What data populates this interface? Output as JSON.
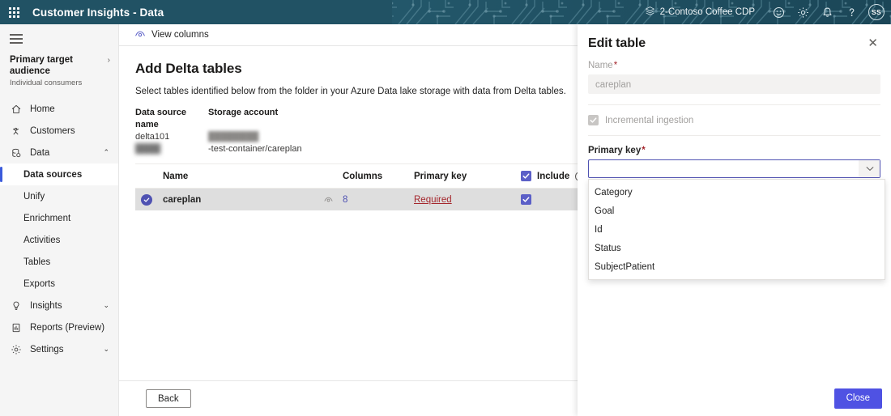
{
  "header": {
    "app_title": "Customer Insights - Data",
    "waffle_icon": "app-launcher-icon",
    "environment": "2-Contoso Coffee CDP",
    "environment_icon": "environment-icon",
    "icons": [
      {
        "name": "feedback-smiley-icon"
      },
      {
        "name": "gear-icon"
      },
      {
        "name": "bell-notification-icon"
      },
      {
        "name": "help-question-icon"
      }
    ],
    "avatar_initials": "SS",
    "bg_color": "#1f4e5f",
    "accent_color": "#4f52b2"
  },
  "sidebar": {
    "hamburger_icon": "hamburger-menu-icon",
    "audience": {
      "title": "Primary target audience",
      "subtitle": "Individual consumers",
      "chevron": "›"
    },
    "items": [
      {
        "label": "Home",
        "icon": "home-icon",
        "type": "top"
      },
      {
        "label": "Customers",
        "icon": "customers-icon",
        "type": "top"
      },
      {
        "label": "Data",
        "icon": "database-icon",
        "type": "top",
        "expanded": true,
        "chevron": "⌃"
      },
      {
        "label": "Data sources",
        "type": "sub",
        "active": true
      },
      {
        "label": "Unify",
        "type": "sub",
        "active": false
      },
      {
        "label": "Enrichment",
        "type": "sub",
        "active": false
      },
      {
        "label": "Activities",
        "type": "sub",
        "active": false
      },
      {
        "label": "Tables",
        "type": "sub",
        "active": false
      },
      {
        "label": "Exports",
        "type": "sub",
        "active": false
      },
      {
        "label": "Insights",
        "icon": "lightbulb-icon",
        "type": "top",
        "expanded": false,
        "chevron": "⌄"
      },
      {
        "label": "Reports (Preview)",
        "icon": "report-icon",
        "type": "top"
      },
      {
        "label": "Settings",
        "icon": "settings-gear-icon",
        "type": "top",
        "expanded": false,
        "chevron": "⌄"
      }
    ]
  },
  "commandbar": {
    "view_columns_label": "View columns",
    "view_columns_icon": "view-columns-eye-icon"
  },
  "main": {
    "page_title": "Add Delta tables",
    "description": "Select tables identified below from the folder in your Azure Data lake storage with data from Delta tables.",
    "meta": {
      "col1_header": "Data source name",
      "col2_header": "Storage account",
      "data_source_name": "delta101",
      "storage_account": "████████",
      "folder_path_prefix": "████",
      "folder_path": "-test-container/careplan"
    },
    "table": {
      "columns": [
        "Name",
        "Columns",
        "Primary key",
        "Include"
      ],
      "include_info_icon": "info-icon",
      "include_header_checked": true,
      "rows": [
        {
          "selected": true,
          "name": "careplan",
          "preview_icon": "preview-eye-icon",
          "columns": "8",
          "primary_key": "Required",
          "include": true
        }
      ]
    },
    "back_button": "Back"
  },
  "panel": {
    "title": "Edit table",
    "close_icon": "close-icon",
    "name_label": "Name",
    "name_required": "*",
    "name_value": "careplan",
    "name_disabled": true,
    "incremental_label": "Incremental ingestion",
    "incremental_checked": true,
    "incremental_disabled": true,
    "primary_key_label": "Primary key",
    "primary_key_required": "*",
    "primary_key_value": "",
    "primary_key_placeholder": "",
    "caret_icon": "chevron-down-icon",
    "options": [
      "Category",
      "Goal",
      "Id",
      "Status",
      "SubjectPatient"
    ],
    "close_button": "Close",
    "close_button_color": "#4f52e3"
  }
}
